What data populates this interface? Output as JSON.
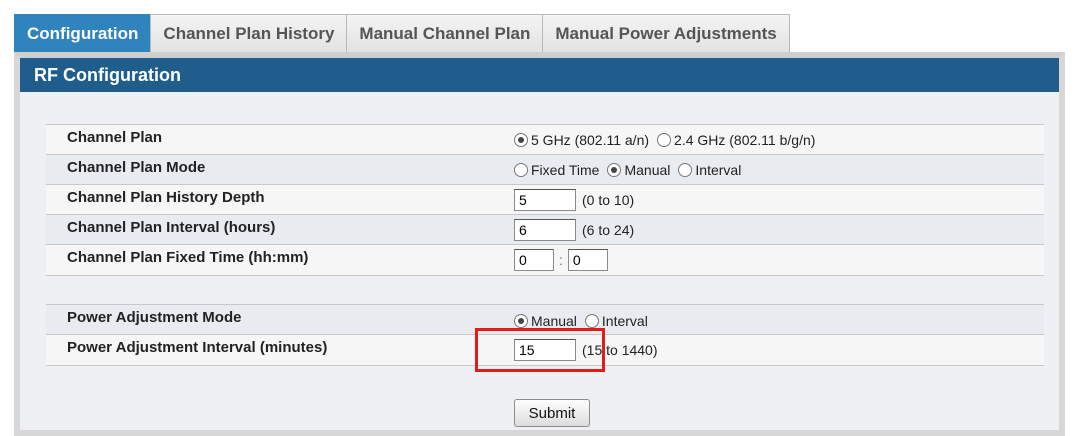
{
  "tabs": [
    {
      "label": "Configuration",
      "active": true
    },
    {
      "label": "Channel Plan History",
      "active": false
    },
    {
      "label": "Manual Channel Plan",
      "active": false
    },
    {
      "label": "Manual Power Adjustments",
      "active": false
    }
  ],
  "panel": {
    "title": "RF Configuration"
  },
  "fields": {
    "channel_plan": {
      "label": "Channel Plan",
      "options": [
        "5 GHz (802.11 a/n)",
        "2.4 GHz (802.11 b/g/n)"
      ],
      "selected": "5 GHz (802.11 a/n)"
    },
    "channel_plan_mode": {
      "label": "Channel Plan Mode",
      "options": [
        "Fixed Time",
        "Manual",
        "Interval"
      ],
      "selected": "Manual"
    },
    "history_depth": {
      "label": "Channel Plan History Depth",
      "value": "5",
      "range": "(0 to 10)"
    },
    "plan_interval": {
      "label": "Channel Plan Interval (hours)",
      "value": "6",
      "range": "(6 to 24)"
    },
    "fixed_time": {
      "label": "Channel Plan Fixed Time (hh:mm)",
      "hours": "0",
      "separator": ":",
      "minutes": "0"
    },
    "power_mode": {
      "label": "Power Adjustment Mode",
      "options": [
        "Manual",
        "Interval"
      ],
      "selected": "Manual"
    },
    "power_interval": {
      "label": "Power Adjustment Interval (minutes)",
      "value": "15",
      "range": "(15 to 1440)"
    }
  },
  "submit_label": "Submit",
  "colors": {
    "tab_active": "#2f84be",
    "panel_header": "#1e5d8c",
    "highlight": "#e21b1b"
  }
}
